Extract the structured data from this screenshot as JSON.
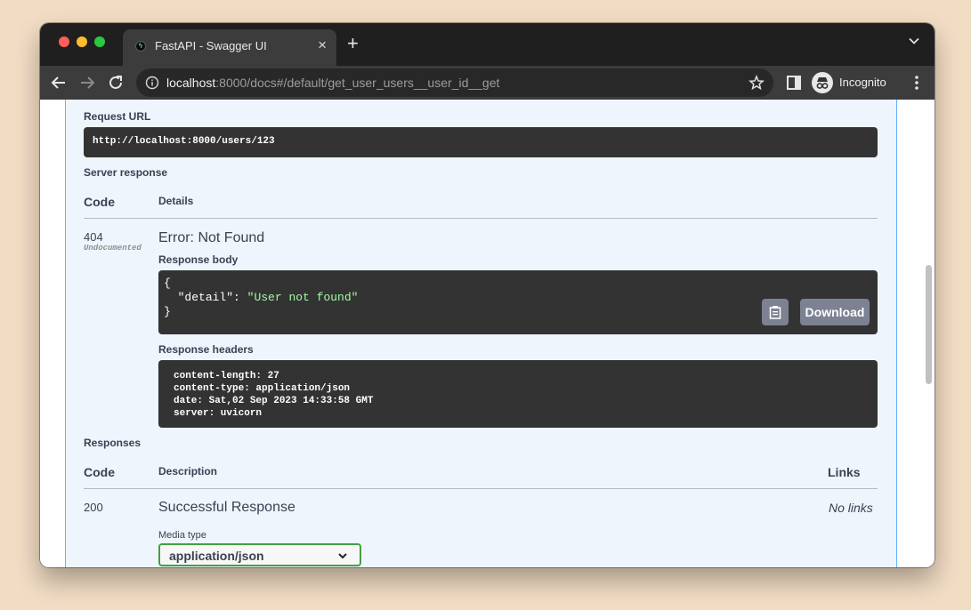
{
  "browser": {
    "tab_title": "FastAPI - Swagger UI",
    "tab_close": "×",
    "new_tab": "+",
    "url_host": "localhost",
    "url_rest": ":8000/docs#/default/get_user_users__user_id__get",
    "incognito_label": "Incognito"
  },
  "execution": {
    "request_url_heading": "Request URL",
    "request_url": "http://localhost:8000/users/123",
    "server_response_heading": "Server response",
    "code_header": "Code",
    "details_header": "Details",
    "response": {
      "code": "404",
      "code_note": "Undocumented",
      "status": "Error: Not Found",
      "body_heading": "Response body",
      "body_lines": [
        "{",
        "  \"detail\": \"User not found\"",
        "}"
      ],
      "body_key": "\"detail\"",
      "body_colon": ": ",
      "body_value": "\"User not found\"",
      "download_label": "Download",
      "headers_heading": "Response headers",
      "headers": [
        "content-length: 27",
        "content-type: application/json",
        "date: Sat,02 Sep 2023 14:33:58 GMT",
        "server: uvicorn"
      ]
    }
  },
  "responses": {
    "heading": "Responses",
    "code_header": "Code",
    "description_header": "Description",
    "links_header": "Links",
    "rows": [
      {
        "code": "200",
        "description": "Successful Response",
        "links": "No links",
        "media_type_label": "Media type",
        "media_type_value": "application/json"
      }
    ]
  },
  "colors": {
    "block_bg": "#eef5fd",
    "block_border": "#61affe",
    "code_bg": "#333333",
    "json_string": "#a2fca2",
    "select_border": "#41a140"
  },
  "icons": [
    "back-icon",
    "forward-icon",
    "reload-icon",
    "info-icon",
    "star-icon",
    "side-panel-icon",
    "incognito-icon",
    "menu-icon",
    "copy-icon",
    "chevron-down-icon",
    "tab-menu-icon"
  ]
}
